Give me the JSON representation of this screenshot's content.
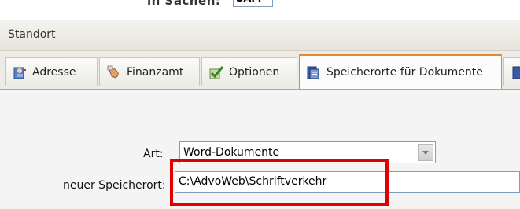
{
  "background_window": {
    "field_label_partial": "in Sachen:",
    "field_value_partial": "SAM"
  },
  "window": {
    "title": "Standort"
  },
  "tabs": [
    {
      "label": "Adresse",
      "icon": "address-book-icon",
      "active": false
    },
    {
      "label": "Finanzamt",
      "icon": "hand-icon",
      "active": false
    },
    {
      "label": "Optionen",
      "icon": "checkmark-icon",
      "active": false
    },
    {
      "label": "Speicherorte für Dokumente",
      "icon": "document-storage-icon",
      "active": true
    }
  ],
  "form": {
    "art_label": "Art:",
    "art_value": "Word-Dokumente",
    "speicherort_label": "neuer Speicherort:",
    "speicherort_value": "C:\\AdvoWeb\\Schriftverkehr"
  },
  "colors": {
    "highlight": "#e00000",
    "active_tab_accent": "#e68b2c",
    "input_border": "#7f9db9"
  }
}
